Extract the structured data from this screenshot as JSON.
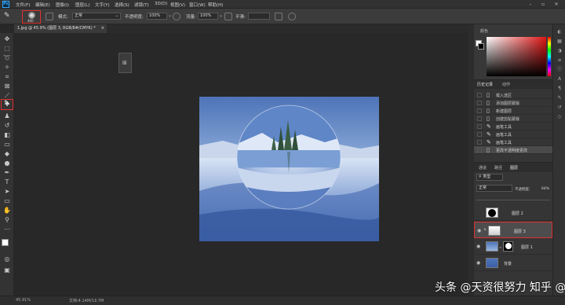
{
  "menubar": {
    "items": [
      "文件(F)",
      "编辑(E)",
      "图像(I)",
      "图层(L)",
      "文字(Y)",
      "选择(S)",
      "滤镜(T)",
      "3D(D)",
      "视图(V)",
      "窗口(W)",
      "帮助(H)"
    ]
  },
  "options": {
    "brush_size": "400",
    "mode_label": "模式:",
    "mode_value": "正常",
    "opacity_label": "不透明度:",
    "opacity_value": "100%",
    "flow_label": "流量:",
    "flow_value": "100%",
    "smooth_label": "平滑:"
  },
  "document": {
    "tab_title": "1.jpg @ 45.9% (图层 3, RGB/8#/CMYK) *"
  },
  "panels": {
    "color_tab": "颜色",
    "history_tab": "历史记录",
    "actions_tab": "动作",
    "history_items": [
      {
        "icon": "document-icon",
        "label": "载入选区"
      },
      {
        "icon": "document-icon",
        "label": "添加图层蒙版"
      },
      {
        "icon": "document-icon",
        "label": "新建图层"
      },
      {
        "icon": "document-icon",
        "label": "创建剪贴蒙版"
      },
      {
        "icon": "brush-icon",
        "label": "画笔工具"
      },
      {
        "icon": "brush-icon",
        "label": "画笔工具"
      },
      {
        "icon": "brush-icon",
        "label": "画笔工具"
      },
      {
        "icon": "document-icon",
        "label": "更改不透明度更改"
      }
    ],
    "layers_tabs": [
      "通道",
      "路径",
      "图层"
    ],
    "layer_kind": "类型",
    "blend_mode": "正常",
    "opacity_label": "不透明度:",
    "opacity_value": "64%",
    "layers": [
      {
        "name": "图层 2",
        "visible": false
      },
      {
        "name": "图层 3",
        "visible": true
      },
      {
        "name": "图层 1",
        "visible": true
      },
      {
        "name": "背景",
        "visible": true
      }
    ]
  },
  "status": {
    "zoom": "45.91%",
    "doc_info": "文档:4.14M/11.7M"
  },
  "watermark": {
    "text": "头条 @天资很努力  知乎 @东山"
  },
  "colors": {
    "accent_red": "#e03030",
    "ps_blue": "#31a8ff"
  }
}
